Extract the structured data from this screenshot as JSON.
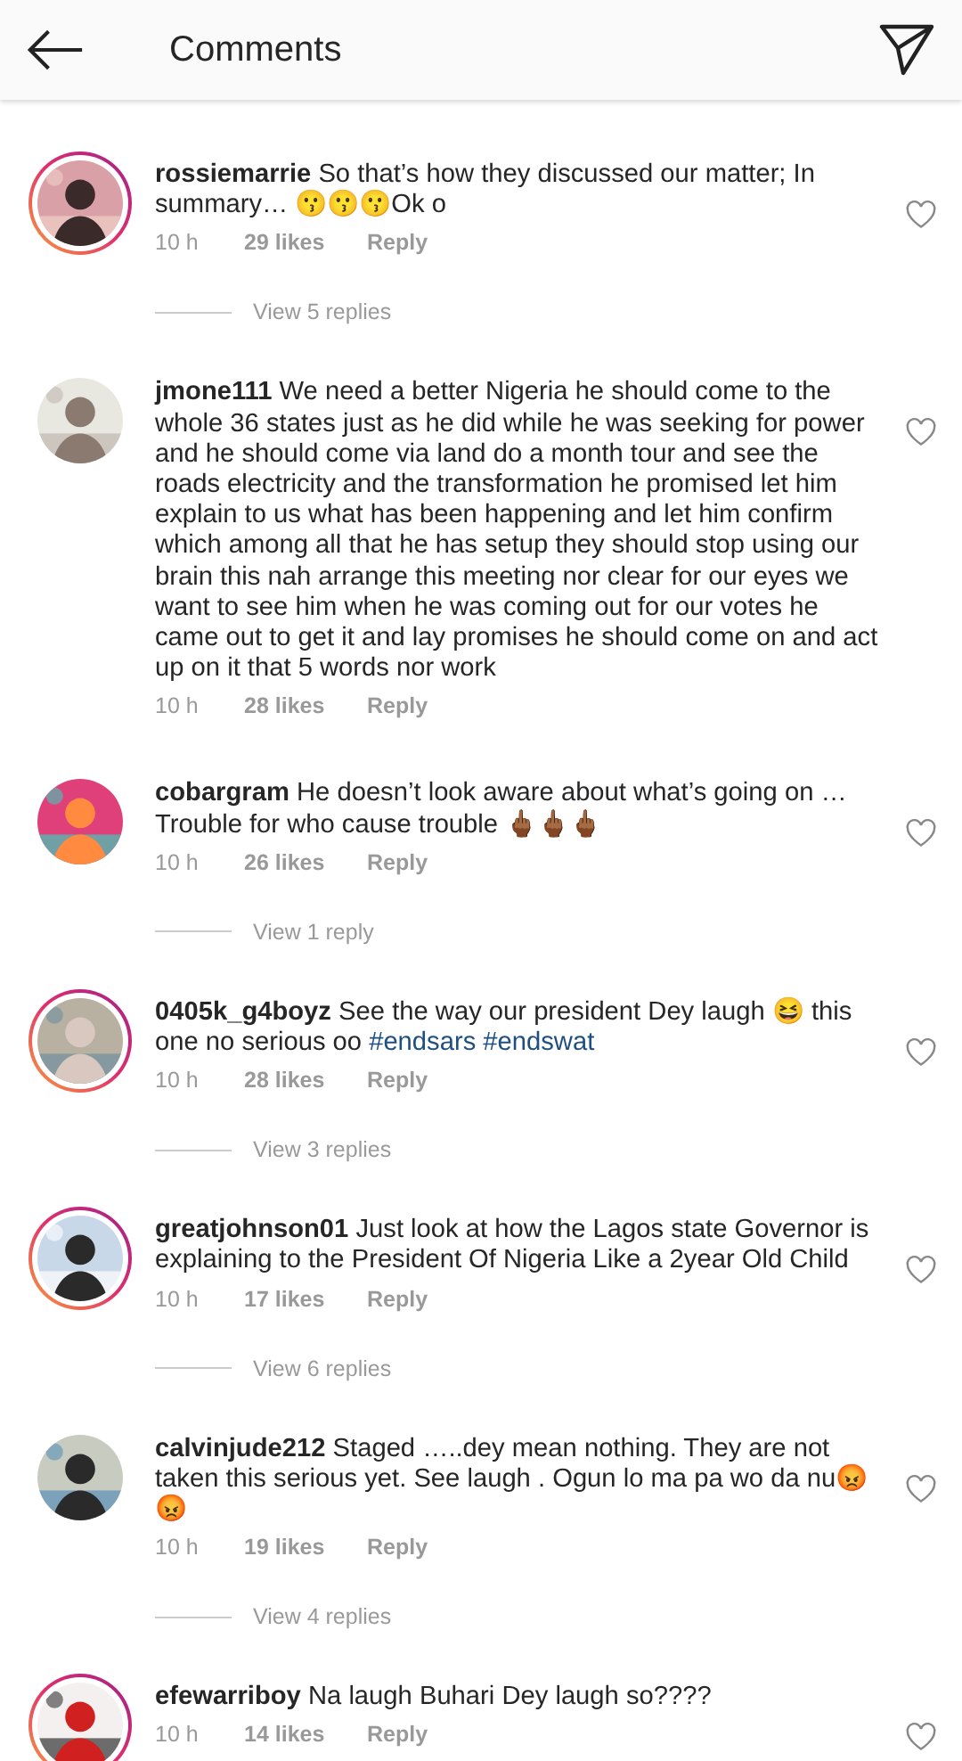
{
  "header": {
    "title": "Comments"
  },
  "comments": [
    {
      "username": "rossiemarrie",
      "story_ring": true,
      "segments": [
        {
          "kind": "plain",
          "text": "So that’s how they discussed our matter; In summary… 😗😗😗Ok o"
        }
      ],
      "time": "10 h",
      "likes": "29 likes",
      "reply": "Reply",
      "view_replies": "View 5 replies"
    },
    {
      "username": "jmone111",
      "story_ring": false,
      "segments": [
        {
          "kind": "plain",
          "text": "We need a better Nigeria he should come to the whole 36 states just as he did while he was seeking for power and he should come via land do a month tour and see the roads electricity and the transformation he promised let him explain to us what has been happening and let him confirm which among all that he has setup they should stop using our brain this nah arrange this meeting nor clear for our eyes we want to see him when he was coming out for our votes he came out to get it and lay promises he should come on and act up on it that 5 words nor work"
        }
      ],
      "time": "10 h",
      "likes": "28 likes",
      "reply": "Reply"
    },
    {
      "username": "cobargram",
      "story_ring": false,
      "segments": [
        {
          "kind": "plain",
          "text": "He doesn’t look aware about what’s going on … Trouble for who cause trouble 🖕🏾🖕🏾🖕🏾"
        }
      ],
      "time": "10 h",
      "likes": "26 likes",
      "reply": "Reply",
      "view_replies": "View 1 reply"
    },
    {
      "username": "0405k_g4boyz",
      "story_ring": true,
      "segments": [
        {
          "kind": "plain",
          "text": "See the way our president Dey laugh 😆 this one no serious oo "
        },
        {
          "kind": "hashtag",
          "text": "#endsars #endswat"
        }
      ],
      "time": "10 h",
      "likes": "28 likes",
      "reply": "Reply",
      "view_replies": "View 3 replies"
    },
    {
      "username": "greatjohnson01",
      "story_ring": true,
      "segments": [
        {
          "kind": "plain",
          "text": "Just look at how the Lagos state Governor is explaining to the President Of Nigeria Like a 2year Old Child"
        }
      ],
      "time": "10 h",
      "likes": "17 likes",
      "reply": "Reply",
      "view_replies": "View 6 replies"
    },
    {
      "username": "calvinjude212",
      "story_ring": false,
      "segments": [
        {
          "kind": "plain",
          "text": "Staged …..dey mean nothing. They are not taken this serious yet. See laugh . Ogun lo ma pa wo da nu😡😡"
        }
      ],
      "time": "10 h",
      "likes": "19 likes",
      "reply": "Reply",
      "view_replies": "View 4 replies"
    },
    {
      "username": "efewarriboy",
      "story_ring": true,
      "segments": [
        {
          "kind": "plain",
          "text": "Na laugh Buhari Dey laugh so????"
        }
      ],
      "time": "10 h",
      "likes": "14 likes",
      "reply": "Reply"
    }
  ]
}
